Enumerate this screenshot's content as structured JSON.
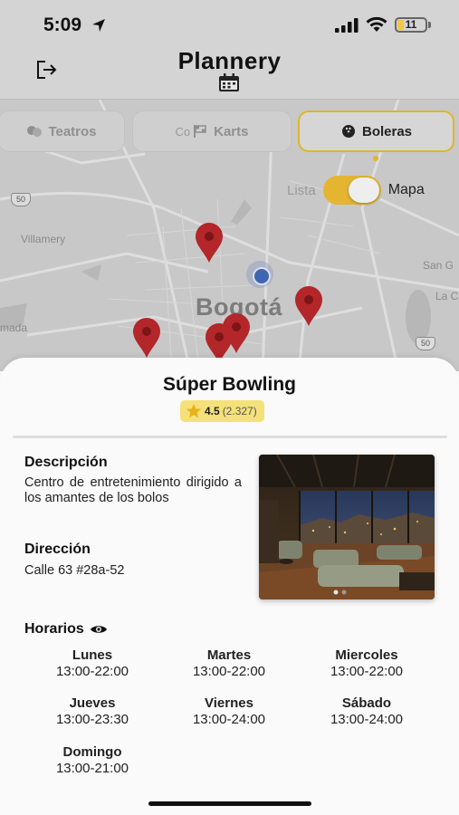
{
  "status_bar": {
    "time": "5:09",
    "battery": "11"
  },
  "app": {
    "title": "Plannery"
  },
  "categories": [
    {
      "label": "Teatros",
      "icon": "theater-masks-icon",
      "active": false
    },
    {
      "label": "Karts",
      "icon": "checkered-flag-icon",
      "active": false
    },
    {
      "label": "Boleras",
      "icon": "bowling-ball-icon",
      "active": true
    }
  ],
  "view_toggle": {
    "off_label": "Lista",
    "on_label": "Mapa"
  },
  "map": {
    "city_label": "Bogotá",
    "place_labels": [
      "Villamery",
      "San G",
      "La C",
      "mada",
      "Co"
    ],
    "route_shields": [
      "50",
      "50"
    ]
  },
  "place": {
    "name": "Súper Bowling",
    "rating": "4.5",
    "rating_count": "(2.327)",
    "description_title": "Descripción",
    "description": "Centro de entretenimiento dirigido a los amantes de los bolos",
    "address_title": "Dirección",
    "address": "Calle 63 #28a-52",
    "hours_title": "Horarios",
    "hours": [
      {
        "day": "Lunes",
        "time": "13:00-22:00"
      },
      {
        "day": "Martes",
        "time": "13:00-22:00"
      },
      {
        "day": "Miercoles",
        "time": "13:00-22:00"
      },
      {
        "day": "Jueves",
        "time": "13:00-23:30"
      },
      {
        "day": "Viernes",
        "time": "13:00-24:00"
      },
      {
        "day": "Sábado",
        "time": "13:00-24:00"
      },
      {
        "day": "Domingo",
        "time": "13:00-21:00"
      }
    ]
  },
  "colors": {
    "accent": "#e3b531",
    "rating_bg": "#f5e17b",
    "pin": "#b3262a"
  }
}
